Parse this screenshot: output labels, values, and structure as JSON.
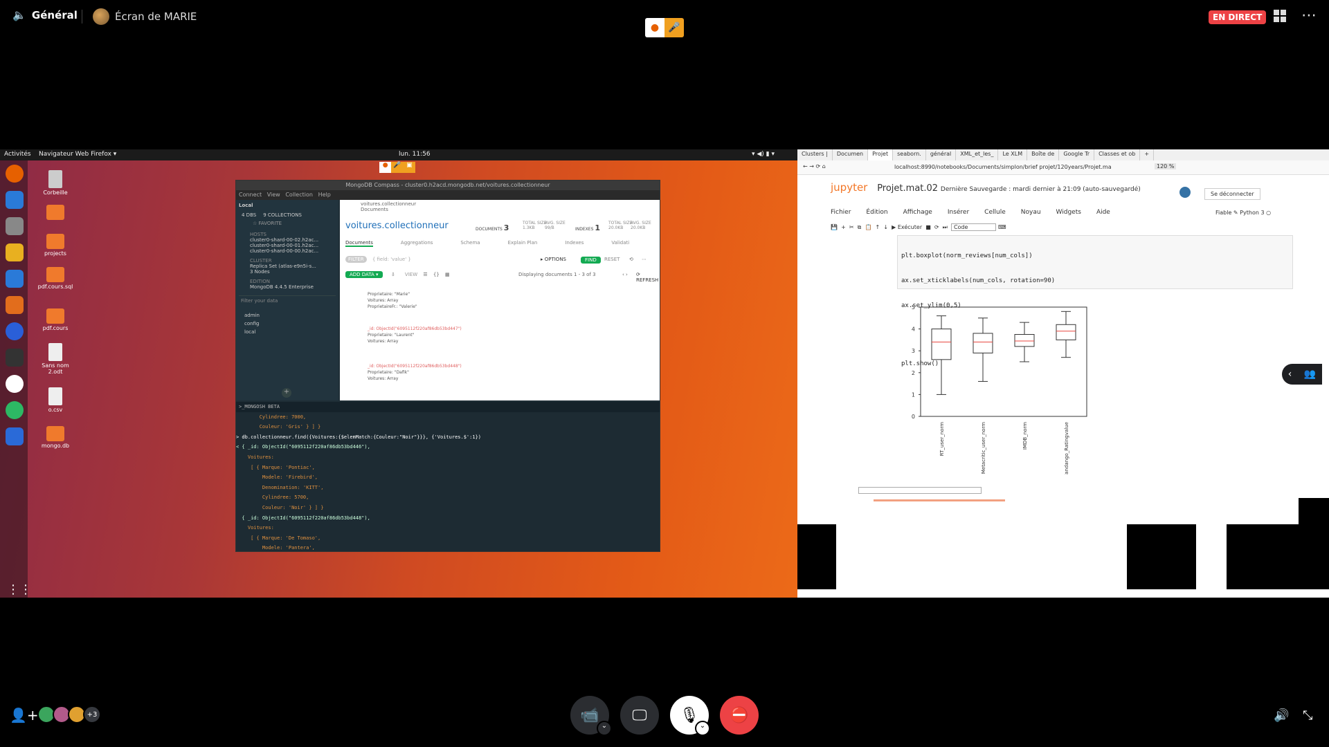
{
  "topbar": {
    "channel": "Général",
    "stream_title": "Écran de MARIE",
    "live_badge": "EN DIRECT",
    "more_label": "⋯"
  },
  "ubuntu": {
    "activities": "Activités",
    "app_menu": "Navigateur Web Firefox ▾",
    "clock": "lun. 11:56",
    "desktop_icons": [
      "Corbeille",
      "projects",
      "pdf.cours.sql",
      "pdf.cours",
      "Sans nom 2.odt",
      "o.csv",
      "mongo.db"
    ]
  },
  "compass": {
    "title": "MongoDB Compass - cluster0.h2acd.mongodb.net/voitures.collectionneur",
    "menu": [
      "Connect",
      "View",
      "Collection",
      "Help"
    ],
    "sidebar_header": "Local",
    "dbs": "4 DBS",
    "collections": "9 COLLECTIONS",
    "favorite": "☆ FAVORITE",
    "hosts_label": "HOSTS",
    "hosts": [
      "cluster0-shard-00-02.h2ac...",
      "cluster0-shard-00-01.h2ac...",
      "cluster0-shard-00-00.h2ac..."
    ],
    "cluster_label": "CLUSTER",
    "cluster": [
      "Replica Set (atlas-e9n5i-s...",
      "3 Nodes"
    ],
    "edition_label": "EDITION",
    "edition": "MongoDB 4.4.5 Enterprise",
    "filter_placeholder": "Filter your data",
    "databases": [
      "admin",
      "config",
      "local"
    ],
    "crumb_top": "voitures.collectionneur",
    "crumb_sub": "Documents",
    "collection_name": "voitures.collectionneur",
    "documents_label": "DOCUMENTS",
    "documents_count": "3",
    "total_size_label": "TOTAL SIZE",
    "total_size": "1.3KB",
    "avg_size_label": "AVG. SIZE",
    "avg_size": "99/B",
    "indexes_label": "INDEXES",
    "indexes_count": "1",
    "idx_total_label": "TOTAL SIZE",
    "idx_total": "20.0KB",
    "idx_avg_label": "AVG. SIZE",
    "idx_avg": "20.0KB",
    "tabs": [
      "Documents",
      "Aggregations",
      "Schema",
      "Explain Plan",
      "Indexes",
      "Validati"
    ],
    "filter_btn": "FILTER",
    "filter_input": "{ field: 'value' }",
    "options": "▸ OPTIONS",
    "find": "FIND",
    "reset": "RESET",
    "add_data": "ADD DATA ▾",
    "view_label": "VIEW",
    "displaying": "Displaying documents 1 - 3 of 3",
    "refresh": "⟳ REFRESH",
    "docs": [
      [
        "Proprietaire: \"Marie\"",
        "Voitures: Array",
        "ProprietaireFr.: \"Valerie\""
      ],
      [
        "_id: ObjectId(\"6095112f220af86db53bd447\")",
        "Proprietaire: \"Laurent\"",
        "Voitures: Array"
      ],
      [
        "_id: ObjectId(\"6095112f220af86db53bd448\")",
        "Proprietaire: \"Dafik\"",
        "Voitures: Array"
      ]
    ],
    "shell_title": ">_MONGOSH BETA",
    "shell_lines": [
      "        Cylindree: 7000,",
      "        Couleur: 'Gris' } ] }",
      "> db.collectionneur.find({Voitures:{$elemMatch:{Couleur:\"Noir\"}}}, {'Voitures.$':1})",
      "< { _id: ObjectId(\"6095112f220af86db53bd446\"),",
      "    Voitures:",
      "     [ { Marque: 'Pontiac',",
      "         Modele: 'Firebird',",
      "         Denomination: 'KITT',",
      "         Cylindree: 5700,",
      "         Couleur: 'Noir' } ] }",
      "  { _id: ObjectId(\"6095112f220af86db53bd448\"),",
      "    Voitures:",
      "     [ { Marque: 'De Tomaso',",
      "         Modele: 'Pantera',"
    ]
  },
  "jupyter": {
    "tabs": [
      "Clusters |",
      "Documen",
      "Projet",
      "seaborn.",
      "général",
      "XML_et_les_",
      "Le XLM",
      "Boîte de",
      "Google Tr",
      "Classes et ob"
    ],
    "url": "localhost:8990/notebooks/Documents/simplon/brief projet/120years/Projet.ma",
    "zoom": "120 %",
    "logo": "jupyter",
    "notebook": "Projet.mat.02",
    "saved": "Dernière Sauvegarde : mardi dernier à 21:09  (auto-sauvegardé)",
    "logout": "Se déconnecter",
    "menu": [
      "Fichier",
      "Édition",
      "Affichage",
      "Insérer",
      "Cellule",
      "Noyau",
      "Widgets",
      "Aide"
    ],
    "trusted": "Fiable",
    "kernel": "Python 3",
    "run": "▶ Exécuter",
    "cell_type": "Code",
    "code_lines": [
      "plt.boxplot(norm_reviews[num_cols])",
      "ax.set_xticklabels(num_cols, rotation=90)",
      "ax.set_ylim(0,5)",
      "",
      "",
      "plt.show()"
    ]
  },
  "chart_data": {
    "type": "boxplot",
    "categories": [
      "RT_user_norm",
      "Metacritic_user_norm",
      "IMDB_norm",
      "Fandango_Ratingvalue"
    ],
    "ylim": [
      0,
      5
    ],
    "yticks": [
      "0",
      "1",
      "2",
      "3",
      "4",
      "5"
    ],
    "boxes": [
      {
        "min": 1.0,
        "q1": 2.6,
        "median": 3.4,
        "q3": 4.0,
        "max": 4.6
      },
      {
        "min": 1.6,
        "q1": 2.9,
        "median": 3.4,
        "q3": 3.8,
        "max": 4.5
      },
      {
        "min": 2.5,
        "q1": 3.2,
        "median": 3.45,
        "q3": 3.75,
        "max": 4.3
      },
      {
        "min": 2.7,
        "q1": 3.5,
        "median": 3.9,
        "q3": 4.2,
        "max": 4.8
      }
    ]
  },
  "bottom": {
    "extra_users": "+3"
  }
}
